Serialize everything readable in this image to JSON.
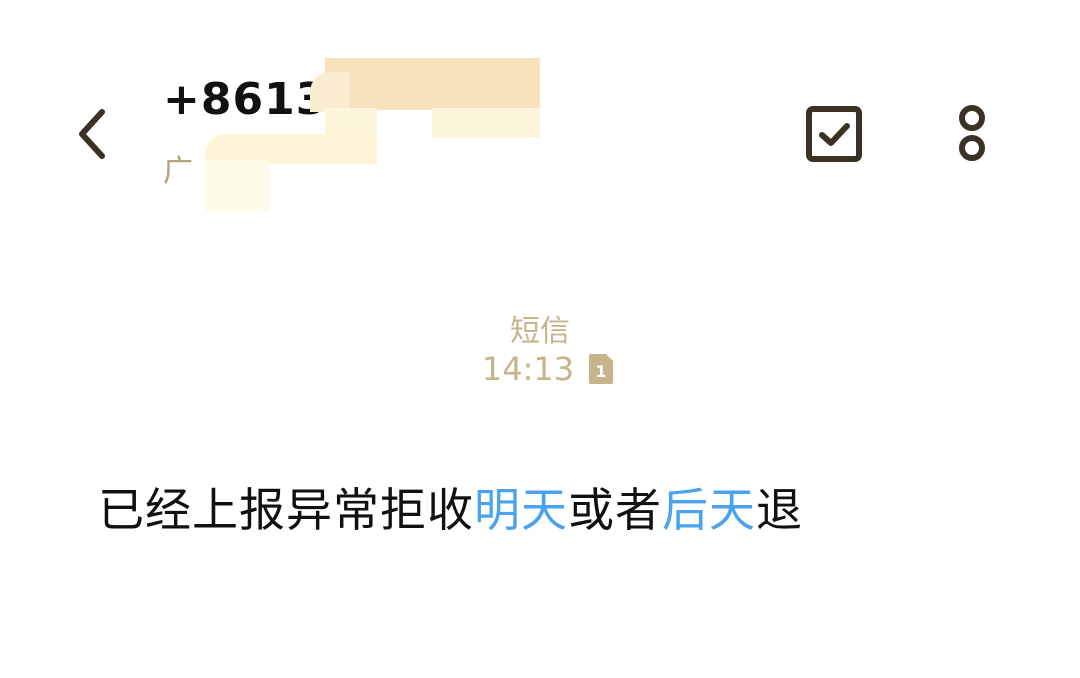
{
  "header": {
    "contact_number": "+8613",
    "contact_sub": "广"
  },
  "icons": {
    "back": "chevron-left-icon",
    "multiselect": "checkbox-checked-icon",
    "more": "more-vertical-icon",
    "sim": "sim-card-1-icon"
  },
  "conversation": {
    "message_type": "短信",
    "time": "14:13",
    "sim_slot": "1"
  },
  "message": {
    "parts": [
      {
        "text": "已经上报异常拒收",
        "link": false
      },
      {
        "text": "明天",
        "link": true
      },
      {
        "text": "或者",
        "link": false
      },
      {
        "text": "后天",
        "link": true
      },
      {
        "text": "退",
        "link": false
      }
    ]
  },
  "colors": {
    "icon": "#3b3226",
    "muted": "#c7b48b",
    "link": "#4ba3ef",
    "text": "#111111"
  }
}
